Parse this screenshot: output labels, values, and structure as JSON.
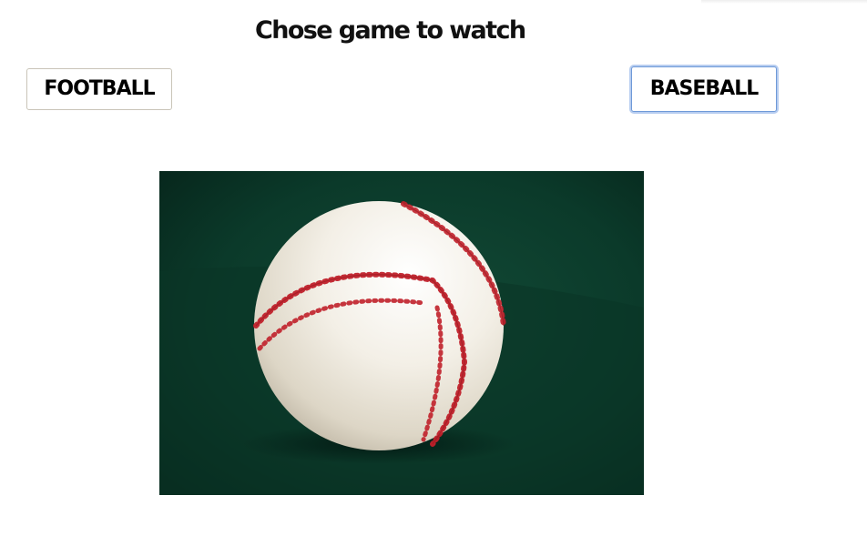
{
  "page": {
    "title": "Chose game to watch"
  },
  "buttons": {
    "football_label": "FOOTBALL",
    "baseball_label": "BASEBALL"
  },
  "image": {
    "subject": "baseball",
    "colors": {
      "background": "#0b3a2a",
      "ball": "#f3efe6",
      "stitches": "#c0202a"
    }
  }
}
